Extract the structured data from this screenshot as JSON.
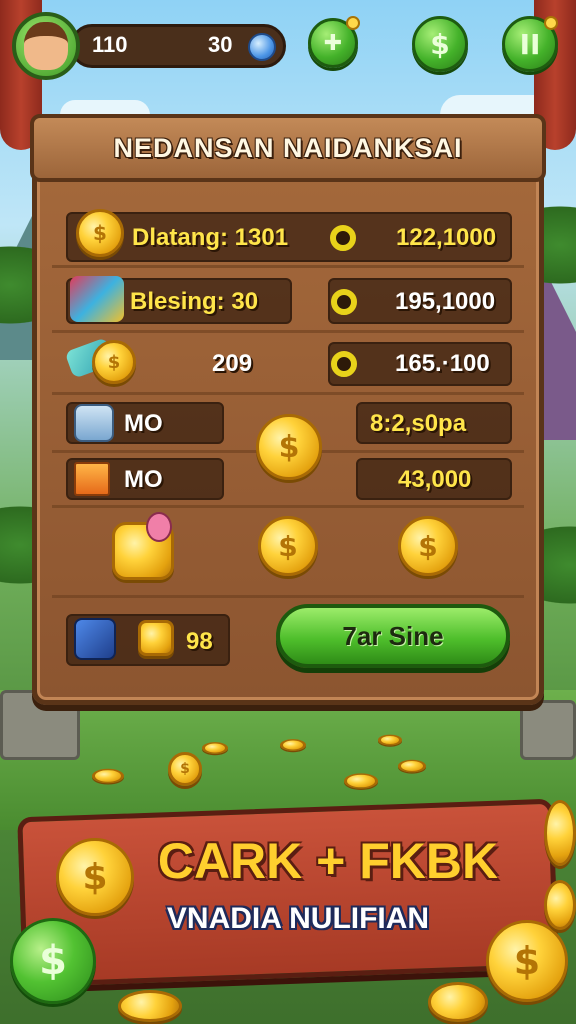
{
  "hud": {
    "lives": "110",
    "gems": "30",
    "avatar_icon": "player-avatar",
    "upgrade_icon": "upgrade-plus",
    "shop_icon": "dollar-coin",
    "pause_icon": "pause",
    "pause_symbol": "II",
    "upgrade_symbol": "✚",
    "shop_symbol": "$"
  },
  "board": {
    "title": "NEDANSAN NAIDANKSAI",
    "rows": [
      {
        "label": "Dlatang: 1301",
        "value": "122,1000"
      },
      {
        "label": "Blesing: 30",
        "value": "195,1000"
      },
      {
        "label": "209",
        "value": "165.·100"
      },
      {
        "label": "MO",
        "value": "8:2,s0pa"
      },
      {
        "label": "MO",
        "value": "43,000"
      }
    ],
    "footer_count": "98",
    "action_button": "7ar Sine"
  },
  "banner": {
    "title": "CARK + FKBK",
    "subtitle": "VNADIA NULIFIAN"
  },
  "coin_symbol": "$",
  "colors": {
    "wood": "#9c653a",
    "accent_green": "#4fbf2c",
    "coin_gold": "#ffd23a",
    "banner_red": "#b8412c",
    "slot_text_yellow": "#ffe54a"
  }
}
